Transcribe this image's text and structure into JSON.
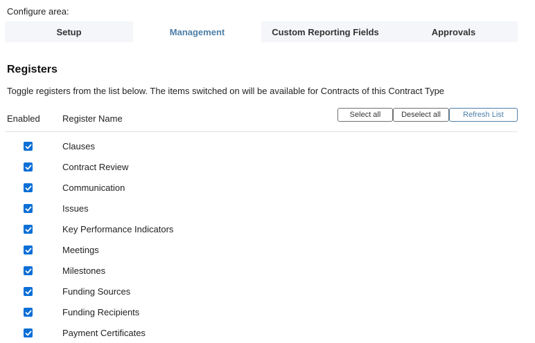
{
  "configure_label": "Configure area:",
  "tabs": [
    {
      "label": "Setup",
      "active": false
    },
    {
      "label": "Management",
      "active": true
    },
    {
      "label": "Custom Reporting Fields",
      "active": false
    },
    {
      "label": "Approvals",
      "active": false
    }
  ],
  "section": {
    "title": "Registers",
    "description": "Toggle registers from the list below. The items switched on will be available for Contracts of this Contract Type"
  },
  "table": {
    "col_enabled": "Enabled",
    "col_name": "Register Name"
  },
  "buttons": {
    "select_all": "Select all",
    "deselect_all": "Deselect all",
    "refresh_list": "Refresh List"
  },
  "colors": {
    "accent": "#4d7ea8",
    "checkbox": "#0b6fd6",
    "tab_bg": "#f4f6f9"
  },
  "registers": [
    {
      "name": "Clauses",
      "enabled": true
    },
    {
      "name": "Contract Review",
      "enabled": true
    },
    {
      "name": "Communication",
      "enabled": true
    },
    {
      "name": "Issues",
      "enabled": true
    },
    {
      "name": "Key Performance Indicators",
      "enabled": true
    },
    {
      "name": "Meetings",
      "enabled": true
    },
    {
      "name": "Milestones",
      "enabled": true
    },
    {
      "name": "Funding Sources",
      "enabled": true
    },
    {
      "name": "Funding Recipients",
      "enabled": true
    },
    {
      "name": "Payment Certificates",
      "enabled": true
    }
  ]
}
